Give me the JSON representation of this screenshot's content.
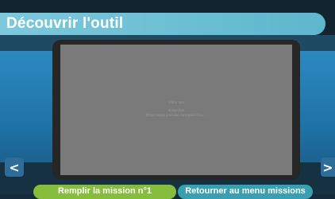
{
  "header": {
    "title": "Découvrir l'outil"
  },
  "video": {
    "message_lines": [
      "Vidéo non",
      "disponible",
      "https://www.youtube.com/watch?v=..."
    ]
  },
  "navigation": {
    "prev_icon": "chevron-left-icon",
    "next_icon": "chevron-right-icon",
    "prev_glyph": "<",
    "next_glyph": ">"
  },
  "actions": {
    "mission_label": "Remplir la mission n°1",
    "menu_label": "Retourner au menu missions"
  },
  "colors": {
    "title_bar": "#6ec0d5",
    "mission_button": "#86bd3d",
    "menu_button": "#3aa0b0",
    "nav_button": "#2e6c99"
  }
}
